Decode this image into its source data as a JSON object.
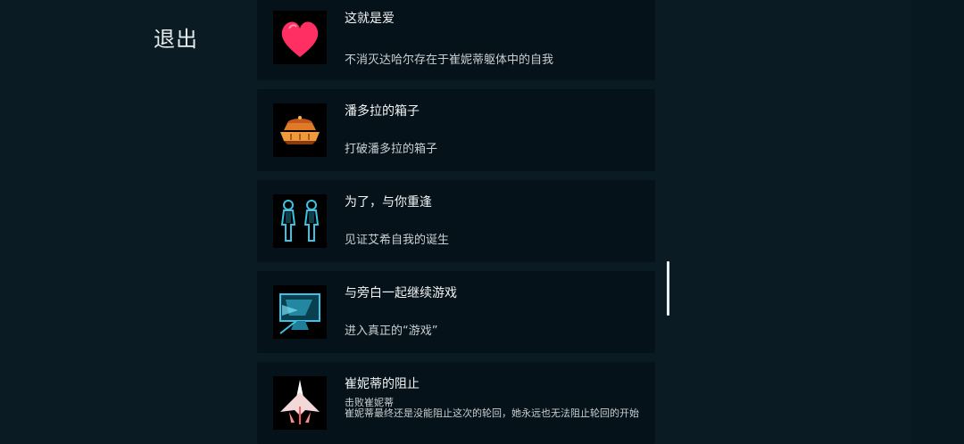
{
  "header": {
    "exit_label": "退出"
  },
  "achievements": [
    {
      "icon": "heart-icon",
      "title": "这就是爱",
      "description": "不消灭达哈尔存在于崔妮蒂躯体中的自我"
    },
    {
      "icon": "pandora-box-icon",
      "title": "潘多拉的箱子",
      "description": "打破潘多拉的箱子"
    },
    {
      "icon": "twin-figures-icon",
      "title": "为了，与你重逢",
      "description": "见证艾希自我的诞生"
    },
    {
      "icon": "monitor-icon",
      "title": "与旁白一起继续游戏",
      "description": "进入真正的“游戏”"
    },
    {
      "icon": "spaceship-icon",
      "title": "崔妮蒂的阻止",
      "subtitle": "击败崔妮蒂",
      "description": "崔妮蒂最终还是没能阻止这次的轮回，她永远也无法阻止轮回的开始"
    }
  ],
  "colors": {
    "background": "#0b1b23",
    "card": "#061219",
    "heart": "#ff2f63",
    "pandora": "#e07a26",
    "cyan": "#39c3e6"
  }
}
